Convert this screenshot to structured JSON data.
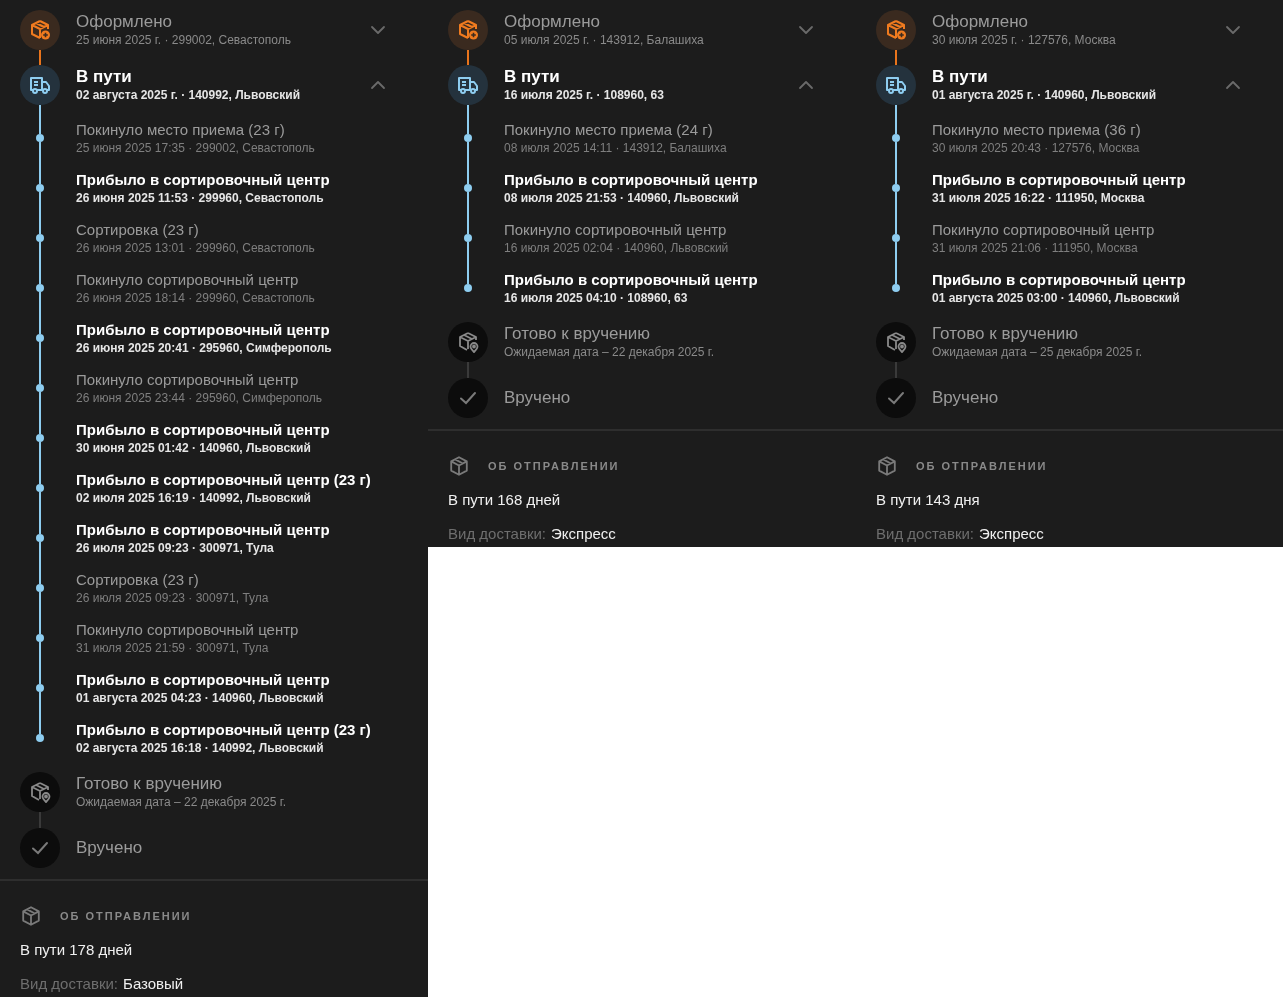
{
  "panels": [
    {
      "stages": [
        {
          "kind": "ordered",
          "title": "Оформлено",
          "subtitle": "25 июня 2025 г. · 299002, Севастополь",
          "current": false,
          "expanded": false
        },
        {
          "kind": "transit",
          "title": "В пути",
          "subtitle": "02 августа 2025 г. · 140992, Львовский",
          "current": true,
          "expanded": true,
          "events": [
            {
              "title": "Покинуло место приема (23 г)",
              "subtitle": "25 июня 2025 17:35 · 299002, Севастополь",
              "bold": false
            },
            {
              "title": "Прибыло в сортировочный центр",
              "subtitle": "26 июня 2025 11:53 · 299960, Севастополь",
              "bold": true
            },
            {
              "title": "Сортировка (23 г)",
              "subtitle": "26 июня 2025 13:01 · 299960, Севастополь",
              "bold": false
            },
            {
              "title": "Покинуло сортировочный центр",
              "subtitle": "26 июня 2025 18:14 · 299960, Севастополь",
              "bold": false
            },
            {
              "title": "Прибыло в сортировочный центр",
              "subtitle": "26 июня 2025 20:41 · 295960, Симферополь",
              "bold": true
            },
            {
              "title": "Покинуло сортировочный центр",
              "subtitle": "26 июня 2025 23:44 · 295960, Симферополь",
              "bold": false
            },
            {
              "title": "Прибыло в сортировочный центр",
              "subtitle": "30 июня 2025 01:42 · 140960, Львовский",
              "bold": true
            },
            {
              "title": "Прибыло в сортировочный центр (23 г)",
              "subtitle": "02 июля 2025 16:19 · 140992, Львовский",
              "bold": true
            },
            {
              "title": "Прибыло в сортировочный центр",
              "subtitle": "26 июля 2025 09:23 · 300971, Тула",
              "bold": true
            },
            {
              "title": "Сортировка (23 г)",
              "subtitle": "26 июля 2025 09:23 · 300971, Тула",
              "bold": false
            },
            {
              "title": "Покинуло сортировочный центр",
              "subtitle": "31 июля 2025 21:59 · 300971, Тула",
              "bold": false
            },
            {
              "title": "Прибыло в сортировочный центр",
              "subtitle": "01 августа 2025 04:23 · 140960, Львовский",
              "bold": true
            },
            {
              "title": "Прибыло в сортировочный центр (23 г)",
              "subtitle": "02 августа 2025 16:18 · 140992, Львовский",
              "bold": true
            }
          ]
        },
        {
          "kind": "ready",
          "title": "Готово к вручению",
          "subtitle": "Ожидаемая дата – 22 декабря 2025 г.",
          "current": false
        },
        {
          "kind": "delivered",
          "title": "Вручено",
          "current": false
        }
      ],
      "info": {
        "heading": "ОБ ОТПРАВЛЕНИИ",
        "duration": "В пути 178 дней",
        "delivery_label": "Вид доставки:",
        "delivery_value": "Базовый"
      }
    },
    {
      "stages": [
        {
          "kind": "ordered",
          "title": "Оформлено",
          "subtitle": "05 июля 2025 г. · 143912, Балашиха",
          "current": false,
          "expanded": false
        },
        {
          "kind": "transit",
          "title": "В пути",
          "subtitle": "16 июля 2025 г. · 108960, 63",
          "current": true,
          "expanded": true,
          "events": [
            {
              "title": "Покинуло место приема (24 г)",
              "subtitle": "08 июля 2025 14:11 · 143912, Балашиха",
              "bold": false
            },
            {
              "title": "Прибыло в сортировочный центр",
              "subtitle": "08 июля 2025 21:53 · 140960, Львовский",
              "bold": true
            },
            {
              "title": "Покинуло сортировочный центр",
              "subtitle": "16 июля 2025 02:04 · 140960, Львовский",
              "bold": false
            },
            {
              "title": "Прибыло в сортировочный центр",
              "subtitle": "16 июля 2025 04:10 · 108960, 63",
              "bold": true
            }
          ]
        },
        {
          "kind": "ready",
          "title": "Готово к вручению",
          "subtitle": "Ожидаемая дата – 22 декабря 2025 г.",
          "current": false
        },
        {
          "kind": "delivered",
          "title": "Вручено",
          "current": false
        }
      ],
      "info": {
        "heading": "ОБ ОТПРАВЛЕНИИ",
        "duration": "В пути 168 дней",
        "delivery_label": "Вид доставки:",
        "delivery_value": "Экспресс"
      }
    },
    {
      "stages": [
        {
          "kind": "ordered",
          "title": "Оформлено",
          "subtitle": "30 июля 2025 г. · 127576, Москва",
          "current": false,
          "expanded": false
        },
        {
          "kind": "transit",
          "title": "В пути",
          "subtitle": "01 августа 2025 г. · 140960, Львовский",
          "current": true,
          "expanded": true,
          "events": [
            {
              "title": "Покинуло место приема (36 г)",
              "subtitle": "30 июля 2025 20:43 · 127576, Москва",
              "bold": false
            },
            {
              "title": "Прибыло в сортировочный центр",
              "subtitle": "31 июля 2025 16:22 · 111950, Москва",
              "bold": true
            },
            {
              "title": "Покинуло сортировочный центр",
              "subtitle": "31 июля 2025 21:06 · 111950, Москва",
              "bold": false
            },
            {
              "title": "Прибыло в сортировочный центр",
              "subtitle": "01 августа 2025 03:00 · 140960, Львовский",
              "bold": true
            }
          ]
        },
        {
          "kind": "ready",
          "title": "Готово к вручению",
          "subtitle": "Ожидаемая дата – 25 декабря 2025 г.",
          "current": false
        },
        {
          "kind": "delivered",
          "title": "Вручено",
          "current": false
        }
      ],
      "info": {
        "heading": "ОБ ОТПРАВЛЕНИИ",
        "duration": "В пути 143 дня",
        "delivery_label": "Вид доставки:",
        "delivery_value": "Экспресс"
      }
    }
  ]
}
